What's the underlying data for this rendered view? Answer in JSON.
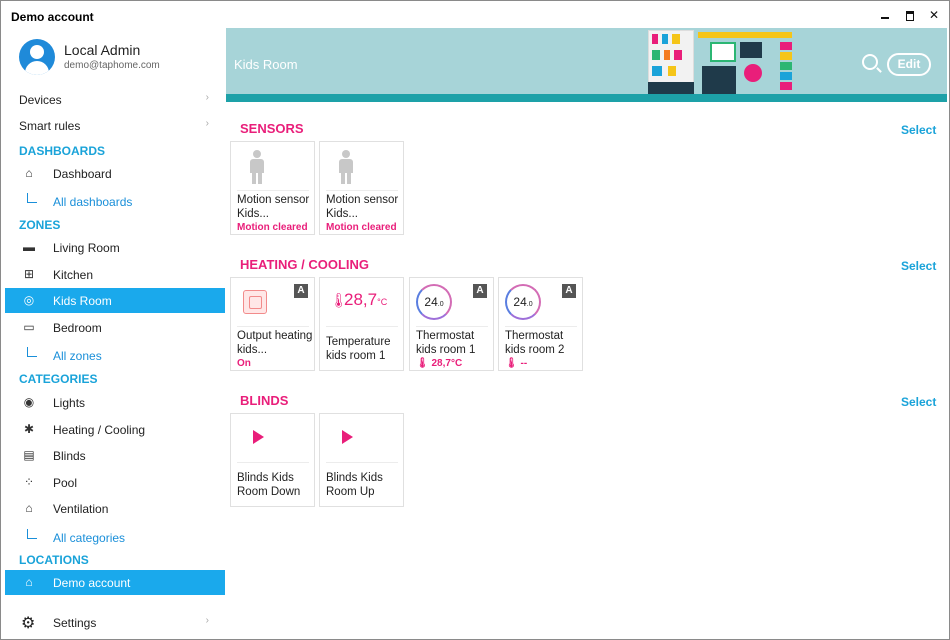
{
  "window": {
    "title": "Demo account"
  },
  "profile": {
    "name": "Local Admin",
    "email": "demo@taphome.com"
  },
  "nav": {
    "devices": "Devices",
    "smart_rules": "Smart rules",
    "chevron": "›"
  },
  "sections": {
    "dashboards": "DASHBOARDS",
    "zones": "ZONES",
    "categories": "CATEGORIES",
    "locations": "LOCATIONS"
  },
  "dashboards": {
    "items": [
      "Dashboard"
    ],
    "all": "All dashboards"
  },
  "zones": {
    "items": [
      "Living Room",
      "Kitchen",
      "Kids Room",
      "Bedroom"
    ],
    "all": "All zones",
    "active": "Kids Room"
  },
  "categories": {
    "items": [
      "Lights",
      "Heating / Cooling",
      "Blinds",
      "Pool",
      "Ventilation"
    ],
    "all": "All categories"
  },
  "locations": {
    "items": [
      "Demo account"
    ]
  },
  "settings": {
    "label": "Settings"
  },
  "header": {
    "title": "Kids Room",
    "edit_label": "Edit"
  },
  "colors": {
    "accent": "#1aa9ec",
    "pink": "#e91e7a",
    "banner": "#a7d4d8",
    "banner_strip": "#1da1a8"
  },
  "content": {
    "select_label": "Select",
    "sensors": {
      "title": "SENSORS",
      "tiles": [
        {
          "name": "Motion sensor Kids...",
          "status": "Motion cleared"
        },
        {
          "name": "Motion sensor Kids...",
          "status": "Motion cleared"
        }
      ]
    },
    "heating": {
      "title": "HEATING / COOLING",
      "tiles": [
        {
          "name": "Output heating kids...",
          "status": "On",
          "badge": "A"
        },
        {
          "name": "Temperature kids room 1",
          "value": "28,7",
          "unit": "°C"
        },
        {
          "name": "Thermostat kids room 1",
          "setpoint": "24",
          "setpoint_sub": ".0",
          "status": "28,7°C",
          "badge": "A"
        },
        {
          "name": "Thermostat kids room 2",
          "setpoint": "24",
          "setpoint_sub": ".0",
          "status": "--",
          "badge": "A"
        }
      ]
    },
    "blinds": {
      "title": "BLINDS",
      "tiles": [
        {
          "name": "Blinds Kids Room Down"
        },
        {
          "name": "Blinds Kids Room Up"
        }
      ]
    }
  }
}
